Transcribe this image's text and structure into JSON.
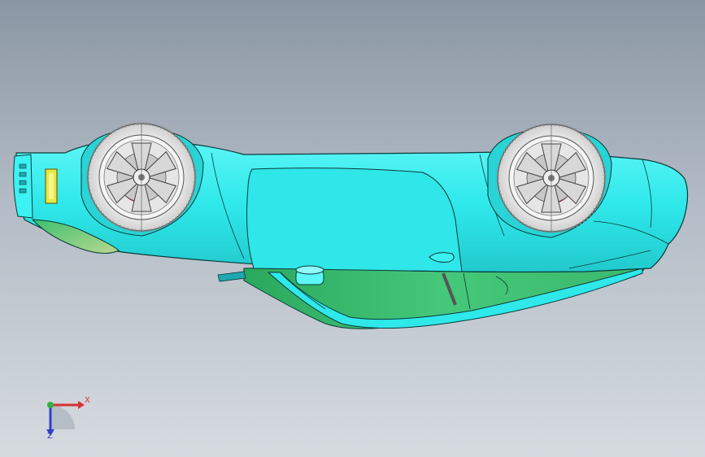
{
  "viewport": {
    "background_top": "#8b96a4",
    "background_bottom": "#d6dbe0"
  },
  "model": {
    "body_color": "#33f0f0",
    "underside_color": "#3fc878",
    "brake_color": "#e03030",
    "tail_light_color": "#e8e840",
    "outline_color": "#0a3a3a"
  },
  "triad": {
    "x_label": "X",
    "z_label": "Z",
    "x_color": "#d83030",
    "y_color": "#30b040",
    "z_color": "#3040c8",
    "icons": [
      "x-axis-arrow-icon",
      "y-axis-dot-icon",
      "z-axis-arrow-icon"
    ]
  }
}
